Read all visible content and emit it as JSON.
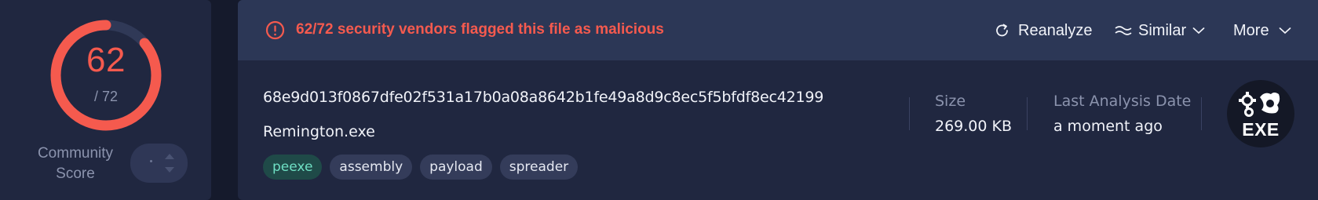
{
  "score": {
    "detections": "62",
    "total": "/ 72",
    "ratio": 0.861,
    "community_label": "Community Score",
    "ring_color": "#f55a4e",
    "ring_track_color": "#303957"
  },
  "alert": {
    "icon": "alert-circle-icon",
    "text": "62/72 security vendors flagged this file as malicious",
    "color": "#f55a4e"
  },
  "actions": {
    "reanalyze": {
      "label": "Reanalyze",
      "icon": "refresh-icon"
    },
    "similar": {
      "label": "Similar",
      "icon": "similar-waves-icon"
    },
    "more": {
      "label": "More",
      "icon": "chevron-down-icon"
    }
  },
  "file": {
    "hash": "68e9d013f0867dfe02f531a17b0a08a8642b1fe49a8d9c8ec5f5bfdf8ec42199",
    "name": "Remington.exe",
    "tags": [
      "peexe",
      "assembly",
      "payload",
      "spreader"
    ],
    "type_label": "EXE"
  },
  "meta": {
    "size_label": "Size",
    "size_value": "269.00 KB",
    "date_label": "Last Analysis Date",
    "date_value": "a moment ago"
  }
}
